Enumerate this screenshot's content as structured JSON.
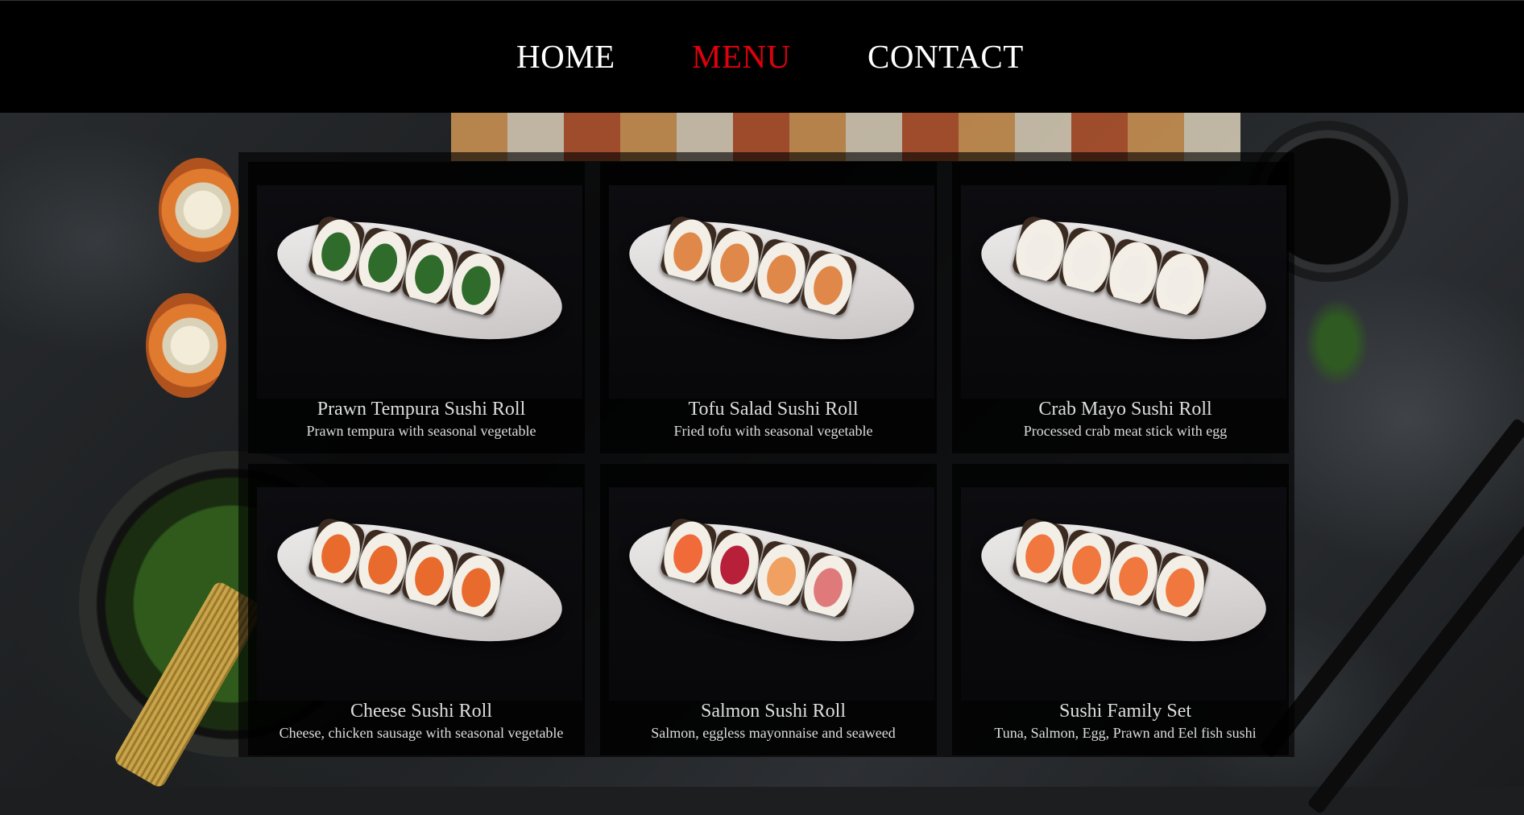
{
  "nav": {
    "home": "HOME",
    "menu": "MENU",
    "contact": "CONTACT",
    "active": "MENU",
    "active_color": "#e0000d"
  },
  "menu_items": [
    {
      "title": "Prawn Tempura Sushi Roll",
      "description": "Prawn tempura with seasonal vegetable",
      "colors": [
        "#2f6b2a",
        "#2f6b2a",
        "#2f6b2a",
        "#2f6b2a"
      ]
    },
    {
      "title": "Tofu Salad Sushi Roll",
      "description": "Fried tofu with seasonal vegetable",
      "colors": [
        "#e0884a",
        "#e0884a",
        "#e0884a",
        "#e0884a"
      ]
    },
    {
      "title": "Crab Mayo Sushi Roll",
      "description": "Processed crab meat stick with egg",
      "colors": [
        "#f2ece6",
        "#f2ece6",
        "#f2ece6",
        "#f2ece6"
      ]
    },
    {
      "title": "Cheese Sushi Roll",
      "description": "Cheese, chicken sausage with seasonal vegetable",
      "colors": [
        "#e86a2c",
        "#e86a2c",
        "#e86a2c",
        "#e86a2c"
      ]
    },
    {
      "title": "Salmon Sushi Roll",
      "description": "Salmon, eggless mayonnaise and seaweed",
      "colors": [
        "#f06a3a",
        "#b8203a",
        "#f0a060",
        "#e07a7a"
      ]
    },
    {
      "title": "Sushi Family Set",
      "description": "Tuna, Salmon, Egg, Prawn and Eel fish sushi",
      "colors": [
        "#f0773e",
        "#f0773e",
        "#f0773e",
        "#f0773e"
      ]
    }
  ]
}
